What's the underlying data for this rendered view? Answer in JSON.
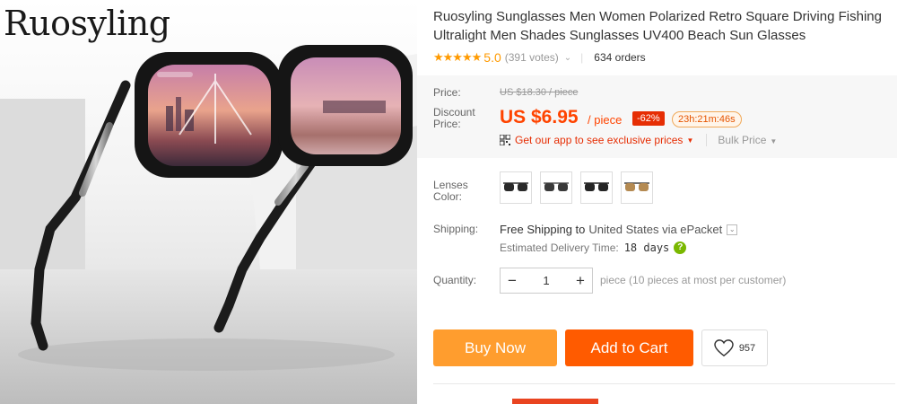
{
  "brand": "Ruosyling",
  "product": {
    "title": "Ruosyling Sunglasses Men Women Polarized Retro Square Driving Fishing Ultralight Men Shades Sunglasses UV400 Beach Sun Glasses",
    "stars": "★★★★★",
    "rating": "5.0",
    "votes": "(391 votes)",
    "orders": "634 orders"
  },
  "price": {
    "label": "Price:",
    "original": "US $18.30 / piece",
    "discount_label_1": "Discount",
    "discount_label_2": "Price:",
    "current": "US $6.95",
    "unit": "/ piece",
    "discount_badge": "-62%",
    "countdown": "23h:21m:46s",
    "app_promo": "Get our app to see exclusive prices",
    "bulk": "Bulk Price"
  },
  "lenses": {
    "label_1": "Lenses",
    "label_2": "Color:",
    "options": [
      {
        "icon": "sunglasses-black-icon",
        "tint": "#2a2a2a"
      },
      {
        "icon": "sunglasses-gray-icon",
        "tint": "#3a3a3a"
      },
      {
        "icon": "sunglasses-dark-icon",
        "tint": "#252525"
      },
      {
        "icon": "sunglasses-brown-icon",
        "tint": "#b48a52"
      }
    ]
  },
  "shipping": {
    "label": "Shipping:",
    "free": "Free Shipping to",
    "destination": "United States via ePacket",
    "estimated_label": "Estimated Delivery Time:",
    "estimated_days": "18 days"
  },
  "quantity": {
    "label": "Quantity:",
    "minus": "−",
    "value": "1",
    "plus": "+",
    "note": "piece (10 pieces at most per customer)"
  },
  "actions": {
    "buy_now": "Buy Now",
    "add_to_cart": "Add to Cart",
    "wishlist_count": "957"
  },
  "colors": {
    "accent_price": "#ff4400",
    "buy_now": "#ff9d2e",
    "add_to_cart": "#ff5b00",
    "stars": "#ff9a00"
  }
}
